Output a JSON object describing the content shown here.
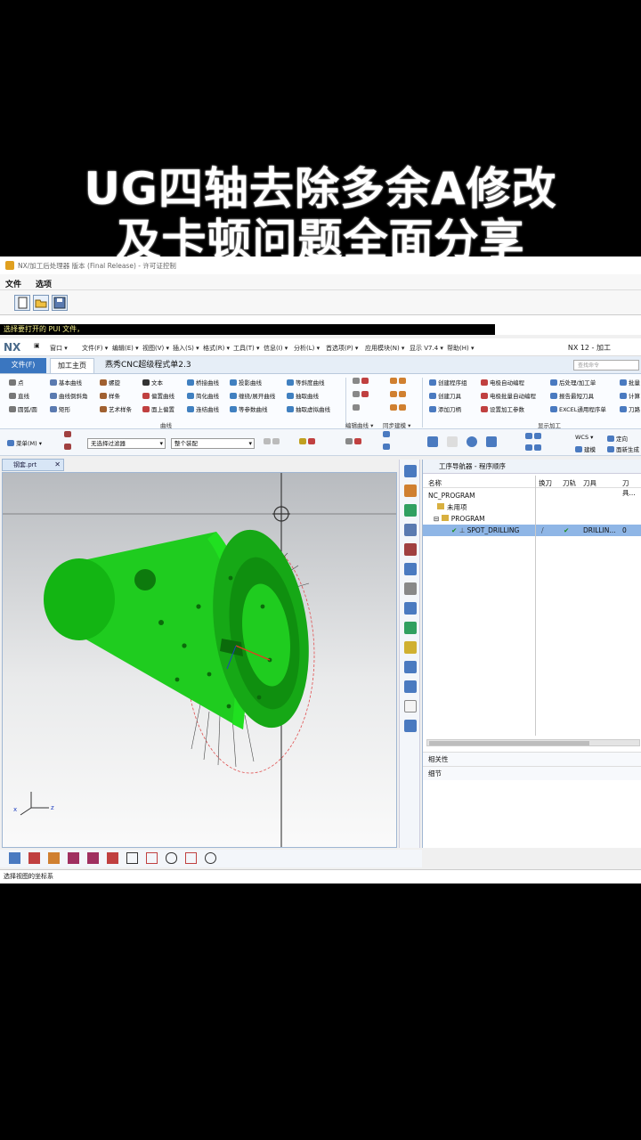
{
  "overlay_title": {
    "line1": "UG四轴去除多余A修改",
    "line2": "及卡顿问题全面分享"
  },
  "pdm_window": {
    "title": "NX/加工后处理器 版本 (Final Release) - 许可证控制",
    "menu": [
      "文件",
      "选项"
    ],
    "status": "选择要打开的 PUI 文件，"
  },
  "nx": {
    "logo": "NX",
    "menu": [
      "窗口 ▾",
      "文件(F) ▾",
      "编辑(E) ▾",
      "视图(V) ▾",
      "插入(S) ▾",
      "格式(R) ▾",
      "工具(T) ▾",
      "信息(I) ▾",
      "分析(L) ▾",
      "首选项(P) ▾",
      "应用模块(N) ▾",
      "显示 V7.4 ▾",
      "帮助(H) ▾"
    ],
    "version": "NX 12 - 加工",
    "search_placeholder": "查找命令"
  },
  "ribbon": {
    "tabs": [
      "文件(F)",
      "加工主页",
      "燕秀CNC超级程式单2.3"
    ],
    "col1": [
      "点",
      "直线",
      "圆弧/圆"
    ],
    "col2": [
      "基本曲线",
      "曲线倒斜角",
      "矩形"
    ],
    "col3": [
      "螺旋",
      "样条",
      "艺术样条"
    ],
    "col4": [
      "文本",
      "偏置曲线",
      "面上偏置"
    ],
    "col5": [
      "桥接曲线",
      "简化曲线",
      "连结曲线"
    ],
    "col6": [
      "投影曲线",
      "缠绕/展开曲线",
      "等参数曲线"
    ],
    "col7": [
      "等斜度曲线",
      "抽取曲线",
      "抽取虚拟曲线"
    ],
    "groups": [
      "曲线",
      "编辑曲线 ▾",
      "同步建模 ▾",
      "显示加工"
    ],
    "right_col1": [
      "创建程序组",
      "创建刀具",
      "添加刀柄"
    ],
    "right_col2": [
      "电极自动编程",
      "电极批量自动编程",
      "设置加工参数"
    ],
    "right_col3": [
      "后处理/加工单",
      "报告最短刀具",
      "EXCEL通用程序单"
    ],
    "right_col4": [
      "批量",
      "计算",
      "刀路"
    ],
    "menu_button": "菜单(M) ▾",
    "filter": "无选择过滤器",
    "assembly": "整个装配",
    "wcs": "WCS ▾",
    "orient": "定向",
    "build": "建模",
    "refresh": "面新生成"
  },
  "viewport": {
    "tab": "钢套.prt"
  },
  "navigator": {
    "header": "工序导航器 - 程序顺序",
    "columns": [
      "名称",
      "换刀",
      "刀轨",
      "刀具",
      "刀具..."
    ],
    "rows": [
      {
        "name": "NC_PROGRAM",
        "tool": "",
        "num": ""
      },
      {
        "name": "未用项",
        "tool": "",
        "num": ""
      },
      {
        "name": "PROGRAM",
        "tool": "",
        "num": ""
      },
      {
        "name": "SPOT_DRILLING",
        "tool": "DRILLIN...",
        "num": "0"
      }
    ],
    "sections": [
      "相关性",
      "细节"
    ]
  },
  "status_bar": "选择视图的坐标系",
  "colors": {
    "part_green": "#1fcc1f",
    "ribbon_blue": "#3a76c0",
    "selection_blue": "#8fb6e6"
  }
}
